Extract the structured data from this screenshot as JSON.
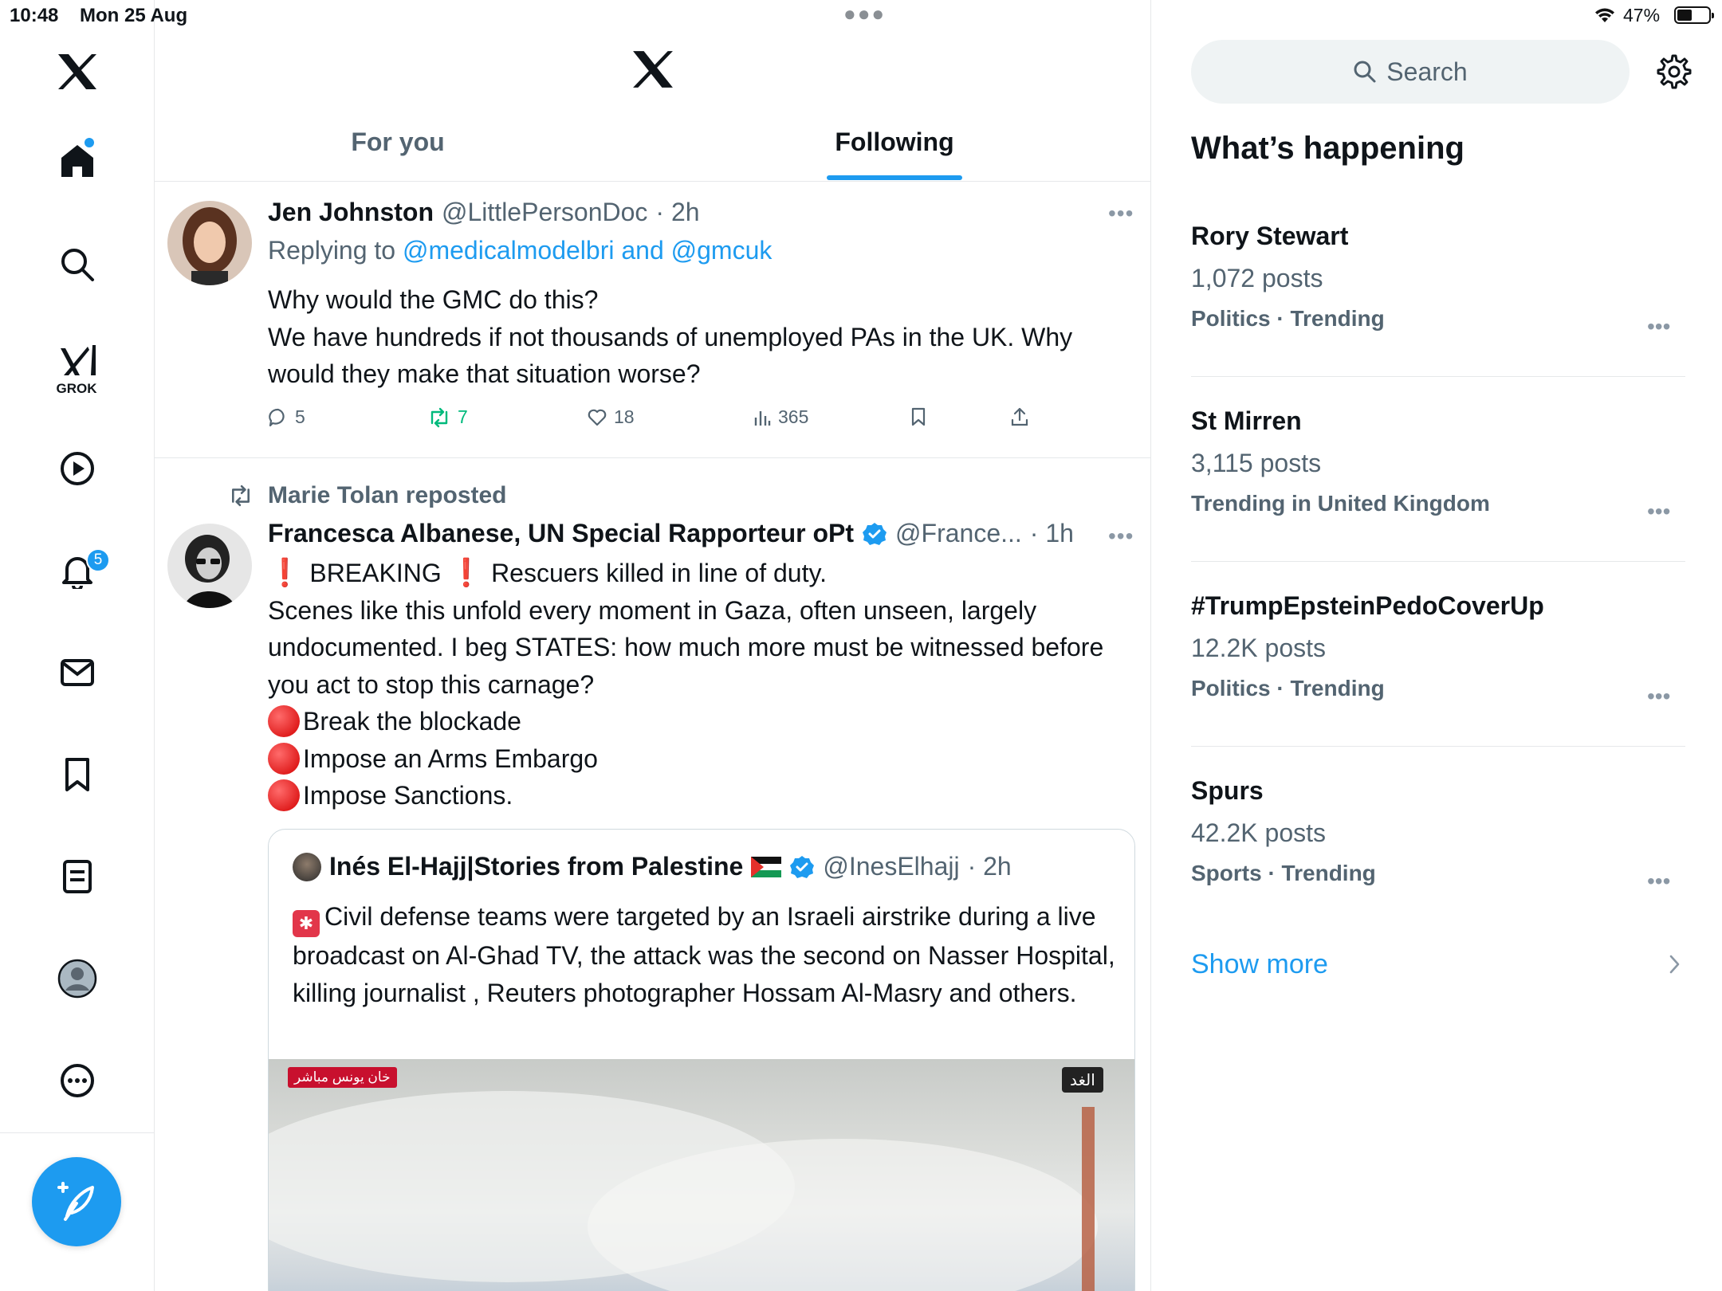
{
  "status_bar": {
    "time": "10:48",
    "date": "Mon 25 Aug",
    "battery": "47%"
  },
  "nav": {
    "grok_label": "GROK",
    "notifications_count": "5",
    "items": [
      "x-logo-icon",
      "home-icon",
      "search-icon",
      "grok-icon",
      "video-icon",
      "bell-icon",
      "mail-icon",
      "bookmark-icon",
      "list-icon",
      "profile-icon",
      "more-icon"
    ]
  },
  "header": {
    "tabs": [
      {
        "label": "For you",
        "active": false
      },
      {
        "label": "Following",
        "active": true
      }
    ]
  },
  "tweets": [
    {
      "name": "Jen Johnston",
      "handle": "@LittlePersonDoc",
      "time": "· 2h",
      "replying_prefix": "Replying to",
      "replying_to": "@medicalmodelbri and @gmcuk",
      "text": "Why would the GMC do this?\nWe have hundreds if not thousands of unemployed PAs in the UK. Why would they make that situation worse?",
      "replies": "5",
      "reposts": "7",
      "likes": "18",
      "views": "365"
    },
    {
      "repost_label": "Marie Tolan reposted",
      "name": "Francesca Albanese, UN Special Rapporteur oPt",
      "handle": "@France...",
      "time": "· 1h",
      "text_line1": "BREAKING",
      "text_line1b": "Rescuers killed in line of duty.",
      "text_body": "Scenes like this unfold every moment in Gaza, often unseen, largely undocumented. I beg STATES: how much more must be witnessed before you act to stop this carnage?",
      "demands": [
        "Break the blockade",
        "Impose an Arms Embargo",
        "Impose Sanctions."
      ],
      "quote": {
        "name": "Inés El-Hajj|Stories from Palestine",
        "handle": "@InesElhajj",
        "time": "· 2h",
        "text": "Civil defense teams were targeted by an Israeli airstrike during a live broadcast on Al-Ghad TV, the attack was the second on Nasser Hospital, killing journalist , Reuters photographer Hossam Al-Masry and others.",
        "media_label_left": "خان يونس مباشر",
        "media_label_right": "الغد"
      }
    }
  ],
  "sidebar": {
    "search_placeholder": "Search",
    "section_title": "What’s happening",
    "trends": [
      {
        "name": "Rory Stewart",
        "count": "1,072 posts",
        "context": "Politics · Trending"
      },
      {
        "name": "St Mirren",
        "count": "3,115 posts",
        "context": "Trending in United Kingdom"
      },
      {
        "name": "#TrumpEpsteinPedoCoverUp",
        "count": "12.2K posts",
        "context": "Politics · Trending"
      },
      {
        "name": "Spurs",
        "count": "42.2K posts",
        "context": "Sports · Trending"
      }
    ],
    "show_more": "Show more"
  },
  "colors": {
    "accent": "#1d9bf0",
    "repost_green": "#00ba7c",
    "secondary_text": "#536471"
  }
}
